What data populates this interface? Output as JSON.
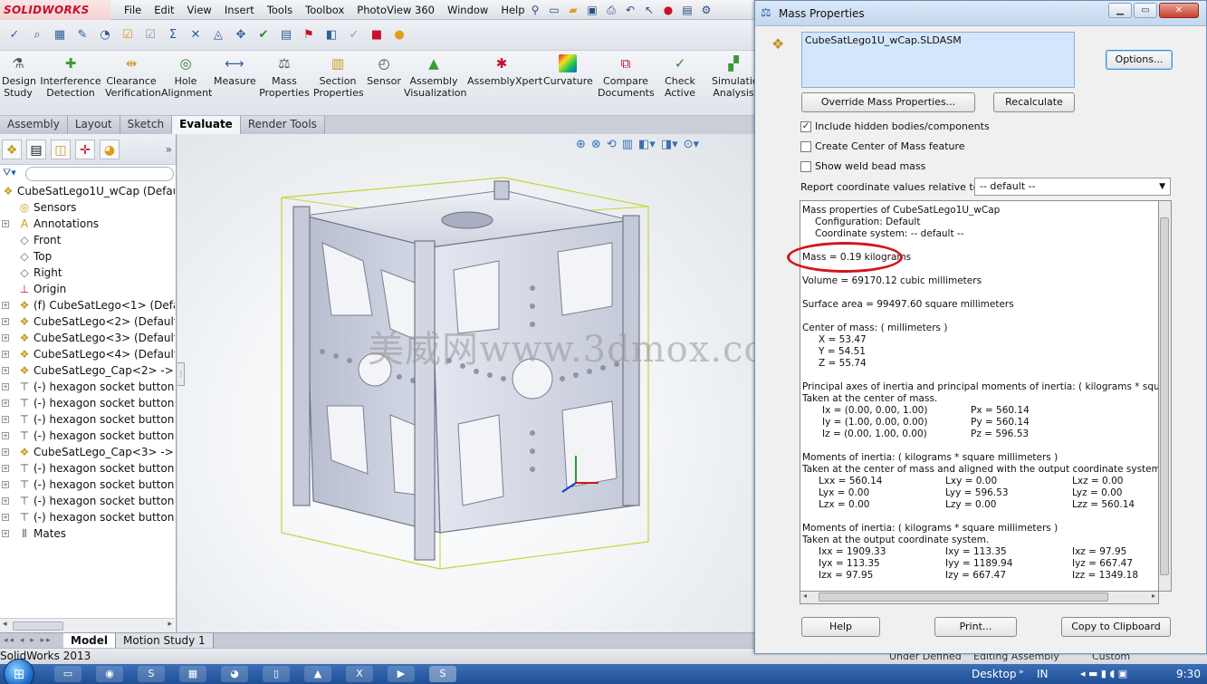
{
  "app": {
    "logo": "SOLIDWORKS",
    "menus": [
      "File",
      "Edit",
      "View",
      "Insert",
      "Tools",
      "Toolbox",
      "PhotoView 360",
      "Window",
      "Help"
    ]
  },
  "command_manager": {
    "buttons": [
      {
        "label": "Design Study"
      },
      {
        "label": "Interference Detection"
      },
      {
        "label": "Clearance Verification"
      },
      {
        "label": "Hole Alignment"
      },
      {
        "label": "Measure"
      },
      {
        "label": "Mass Properties"
      },
      {
        "label": "Section Properties"
      },
      {
        "label": "Sensor"
      },
      {
        "label": "Assembly Visualization"
      },
      {
        "label": "AssemblyXpert"
      },
      {
        "label": "Curvature"
      },
      {
        "label": "Compare Documents"
      },
      {
        "label": "Check Active"
      },
      {
        "label": "Simulation Analysis"
      }
    ],
    "tabs": [
      "Assembly",
      "Layout",
      "Sketch",
      "Evaluate",
      "Render Tools"
    ],
    "active_tab": "Evaluate"
  },
  "feature_tree": {
    "items": [
      {
        "label": "CubeSatLego1U_wCap  (Default<",
        "icon": "assembly-icon",
        "expander": ""
      },
      {
        "label": "Sensors",
        "icon": "sensors-icon",
        "expander": ""
      },
      {
        "label": "Annotations",
        "icon": "annotations-icon",
        "expander": "+"
      },
      {
        "label": "Front",
        "icon": "plane-icon",
        "expander": ""
      },
      {
        "label": "Top",
        "icon": "plane-icon",
        "expander": ""
      },
      {
        "label": "Right",
        "icon": "plane-icon",
        "expander": ""
      },
      {
        "label": "Origin",
        "icon": "origin-icon",
        "expander": ""
      },
      {
        "label": "(f) CubeSatLego<1> (Default<",
        "icon": "subassembly-icon",
        "expander": "+"
      },
      {
        "label": "CubeSatLego<2> (Default<<I",
        "icon": "subassembly-icon",
        "expander": "+"
      },
      {
        "label": "CubeSatLego<3> (Default<<I",
        "icon": "subassembly-icon",
        "expander": "+"
      },
      {
        "label": "CubeSatLego<4> (Default<<I",
        "icon": "subassembly-icon",
        "expander": "+"
      },
      {
        "label": "CubeSatLego_Cap<2> -> (De",
        "icon": "subassembly-icon",
        "expander": "+"
      },
      {
        "label": "(-) hexagon socket button hea",
        "icon": "screw-icon",
        "expander": "+"
      },
      {
        "label": "(-) hexagon socket button hea",
        "icon": "screw-icon",
        "expander": "+"
      },
      {
        "label": "(-) hexagon socket button hea",
        "icon": "screw-icon",
        "expander": "+"
      },
      {
        "label": "(-) hexagon socket button hea",
        "icon": "screw-icon",
        "expander": "+"
      },
      {
        "label": "CubeSatLego_Cap<3> -> (De",
        "icon": "subassembly-icon",
        "expander": "+"
      },
      {
        "label": "(-) hexagon socket button hea",
        "icon": "screw-icon",
        "expander": "+"
      },
      {
        "label": "(-) hexagon socket button hea",
        "icon": "screw-icon",
        "expander": "+"
      },
      {
        "label": "(-) hexagon socket button hea",
        "icon": "screw-icon",
        "expander": "+"
      },
      {
        "label": "(-) hexagon socket button hea",
        "icon": "screw-icon",
        "expander": "+"
      },
      {
        "label": "Mates",
        "icon": "mates-icon",
        "expander": "+"
      }
    ]
  },
  "viewport": {
    "watermark": "美威网www.3dmox.com",
    "accent": "#c7d33b"
  },
  "model_tabs": [
    "Model",
    "Motion Study 1"
  ],
  "status": {
    "version": "SolidWorks 2013",
    "state": "Under Defined",
    "mode": "Editing Assembly",
    "units": "Custom"
  },
  "taskbar": {
    "lang": "IN",
    "desktop": "Desktop",
    "time": "9:30"
  },
  "dialog": {
    "title": "Mass Properties",
    "selection": "CubeSatLego1U_wCap.SLDASM",
    "options_button": "Options...",
    "override_button": "Override Mass Properties...",
    "recalculate_button": "Recalculate",
    "include_hidden_label": "Include hidden bodies/components",
    "include_hidden_checked": true,
    "create_com_label": "Create Center of Mass feature",
    "create_com_checked": false,
    "weld_bead_label": "Show weld bead mass",
    "weld_bead_checked": false,
    "report_label": "Report coordinate values relative to:",
    "report_value": "-- default --",
    "help_button": "Help",
    "print_button": "Print...",
    "copy_button": "Copy to Clipboard",
    "highlight_color": "#d4141c",
    "results": {
      "header": "Mass properties of CubeSatLego1U_wCap",
      "configuration": "Configuration: Default",
      "coord_system": "Coordinate system: -- default --",
      "mass": "Mass = 0.19 kilograms",
      "volume": "Volume = 69170.12  cubic millimeters",
      "surface_area": "Surface area = 99497.60  square millimeters",
      "com_header": "Center of mass: ( millimeters )",
      "com_x": "X = 53.47",
      "com_y": "Y = 54.51",
      "com_z": "Z = 55.74",
      "principal_header": "Principal axes of inertia and principal moments of inertia: ( kilograms *  square milli",
      "principal_taken": "Taken at the center of mass.",
      "principal_rows": [
        {
          "axis": "Ix = (0.00, 0.00, 1.00)",
          "moment": "Px = 560.14"
        },
        {
          "axis": "Iy = (1.00, 0.00, 0.00)",
          "moment": "Py = 560.14"
        },
        {
          "axis": "Iz = (0.00, 1.00, 0.00)",
          "moment": "Pz = 596.53"
        }
      ],
      "moi_com_header": "Moments of inertia: ( kilograms *  square millimeters )",
      "moi_com_taken": "Taken at the center of mass and aligned with the output coordinate system.",
      "moi_com_rows": [
        [
          "Lxx = 560.14",
          "Lxy = 0.00",
          "Lxz = 0.00"
        ],
        [
          "Lyx = 0.00",
          "Lyy = 596.53",
          "Lyz = 0.00"
        ],
        [
          "Lzx = 0.00",
          "Lzy = 0.00",
          "Lzz = 560.14"
        ]
      ],
      "moi_out_header": "Moments of inertia: ( kilograms *  square millimeters )",
      "moi_out_taken": "Taken at the output coordinate system.",
      "moi_out_rows": [
        [
          "Ixx = 1909.33",
          "Ixy = 113.35",
          "Ixz = 97.95"
        ],
        [
          "Iyx = 113.35",
          "Iyy = 1189.94",
          "Iyz = 667.47"
        ],
        [
          "Izx = 97.95",
          "Izy = 667.47",
          "Izz = 1349.18"
        ]
      ]
    }
  }
}
